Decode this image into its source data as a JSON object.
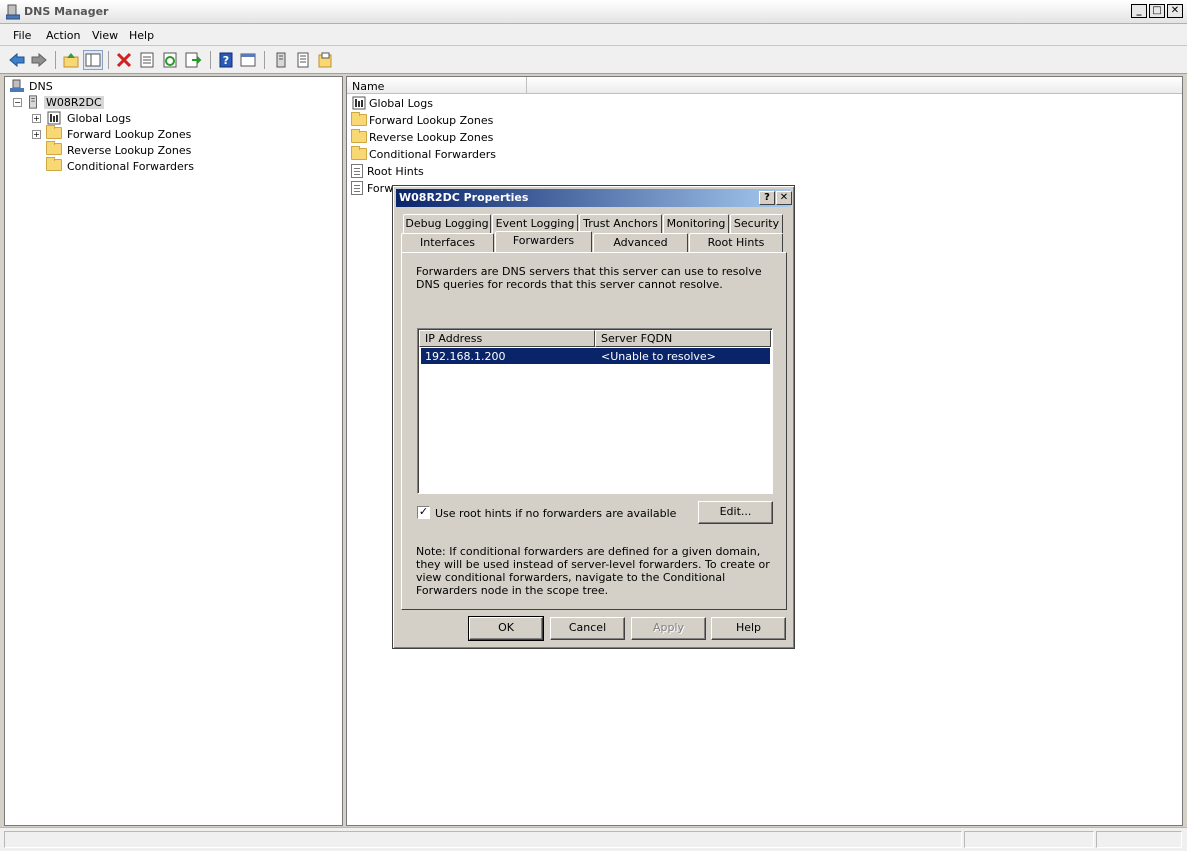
{
  "window": {
    "title": "DNS Manager",
    "minimize": "_",
    "maximize": "□",
    "close": "✕"
  },
  "menu": [
    "File",
    "Action",
    "View",
    "Help"
  ],
  "toolbar_icons": [
    "back-icon",
    "forward-icon",
    "up-icon",
    "show-hide-tree-icon",
    "delete-icon",
    "properties-icon",
    "refresh-icon",
    "export-icon",
    "help-icon",
    "console-icon",
    "server-icon",
    "list-icon",
    "zone-icon"
  ],
  "tree": {
    "root": "DNS",
    "server": "W08R2DC",
    "children": [
      "Global Logs",
      "Forward Lookup Zones",
      "Reverse Lookup Zones",
      "Conditional Forwarders"
    ]
  },
  "list": {
    "column": "Name",
    "items": [
      "Global Logs",
      "Forward Lookup Zones",
      "Reverse Lookup Zones",
      "Conditional Forwarders",
      "Root Hints",
      "Forw"
    ]
  },
  "dialog": {
    "title": "W08R2DC Properties",
    "help_btn": "?",
    "close_btn": "✕",
    "tabs_row1": [
      "Debug Logging",
      "Event Logging",
      "Trust Anchors",
      "Monitoring",
      "Security"
    ],
    "tabs_row2": [
      "Interfaces",
      "Forwarders",
      "Advanced",
      "Root Hints"
    ],
    "active_tab": "Forwarders",
    "description": "Forwarders are DNS servers that this server can use to resolve DNS queries for records that this server cannot resolve.",
    "table": {
      "headers": [
        "IP Address",
        "Server FQDN"
      ],
      "rows": [
        {
          "ip": "192.168.1.200",
          "fqdn": "<Unable to resolve>"
        }
      ]
    },
    "checkbox_label": "Use root hints if no forwarders are available",
    "checkbox_checked": true,
    "check_mark": "✓",
    "edit_button": "Edit...",
    "note": "Note: If conditional forwarders are defined for a given domain, they will be used instead of server-level forwarders.  To create or view conditional forwarders, navigate to the Conditional Forwarders node in the scope tree.",
    "buttons": {
      "ok": "OK",
      "cancel": "Cancel",
      "apply": "Apply",
      "help": "Help"
    }
  },
  "colors": {
    "selection": "#0a246a",
    "title_gradient_start": "#0a246a",
    "title_gradient_end": "#a6caf0"
  }
}
